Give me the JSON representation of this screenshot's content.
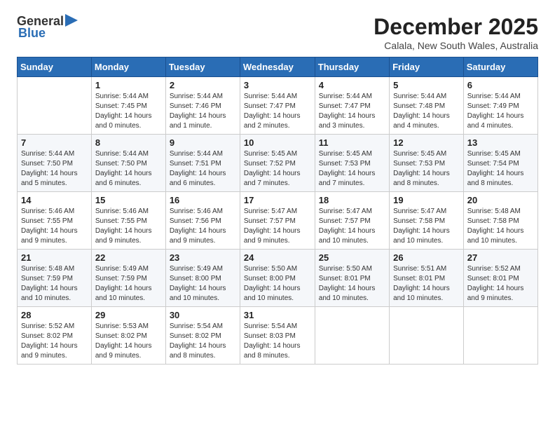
{
  "logo": {
    "text_general": "General",
    "text_blue": "Blue"
  },
  "title": {
    "month": "December 2025",
    "location": "Calala, New South Wales, Australia"
  },
  "weekdays": [
    "Sunday",
    "Monday",
    "Tuesday",
    "Wednesday",
    "Thursday",
    "Friday",
    "Saturday"
  ],
  "weeks": [
    [
      {
        "day": "",
        "sunrise": "",
        "sunset": "",
        "daylight": ""
      },
      {
        "day": "1",
        "sunrise": "Sunrise: 5:44 AM",
        "sunset": "Sunset: 7:45 PM",
        "daylight": "Daylight: 14 hours and 0 minutes."
      },
      {
        "day": "2",
        "sunrise": "Sunrise: 5:44 AM",
        "sunset": "Sunset: 7:46 PM",
        "daylight": "Daylight: 14 hours and 1 minute."
      },
      {
        "day": "3",
        "sunrise": "Sunrise: 5:44 AM",
        "sunset": "Sunset: 7:47 PM",
        "daylight": "Daylight: 14 hours and 2 minutes."
      },
      {
        "day": "4",
        "sunrise": "Sunrise: 5:44 AM",
        "sunset": "Sunset: 7:47 PM",
        "daylight": "Daylight: 14 hours and 3 minutes."
      },
      {
        "day": "5",
        "sunrise": "Sunrise: 5:44 AM",
        "sunset": "Sunset: 7:48 PM",
        "daylight": "Daylight: 14 hours and 4 minutes."
      },
      {
        "day": "6",
        "sunrise": "Sunrise: 5:44 AM",
        "sunset": "Sunset: 7:49 PM",
        "daylight": "Daylight: 14 hours and 4 minutes."
      }
    ],
    [
      {
        "day": "7",
        "sunrise": "Sunrise: 5:44 AM",
        "sunset": "Sunset: 7:50 PM",
        "daylight": "Daylight: 14 hours and 5 minutes."
      },
      {
        "day": "8",
        "sunrise": "Sunrise: 5:44 AM",
        "sunset": "Sunset: 7:50 PM",
        "daylight": "Daylight: 14 hours and 6 minutes."
      },
      {
        "day": "9",
        "sunrise": "Sunrise: 5:44 AM",
        "sunset": "Sunset: 7:51 PM",
        "daylight": "Daylight: 14 hours and 6 minutes."
      },
      {
        "day": "10",
        "sunrise": "Sunrise: 5:45 AM",
        "sunset": "Sunset: 7:52 PM",
        "daylight": "Daylight: 14 hours and 7 minutes."
      },
      {
        "day": "11",
        "sunrise": "Sunrise: 5:45 AM",
        "sunset": "Sunset: 7:53 PM",
        "daylight": "Daylight: 14 hours and 7 minutes."
      },
      {
        "day": "12",
        "sunrise": "Sunrise: 5:45 AM",
        "sunset": "Sunset: 7:53 PM",
        "daylight": "Daylight: 14 hours and 8 minutes."
      },
      {
        "day": "13",
        "sunrise": "Sunrise: 5:45 AM",
        "sunset": "Sunset: 7:54 PM",
        "daylight": "Daylight: 14 hours and 8 minutes."
      }
    ],
    [
      {
        "day": "14",
        "sunrise": "Sunrise: 5:46 AM",
        "sunset": "Sunset: 7:55 PM",
        "daylight": "Daylight: 14 hours and 9 minutes."
      },
      {
        "day": "15",
        "sunrise": "Sunrise: 5:46 AM",
        "sunset": "Sunset: 7:55 PM",
        "daylight": "Daylight: 14 hours and 9 minutes."
      },
      {
        "day": "16",
        "sunrise": "Sunrise: 5:46 AM",
        "sunset": "Sunset: 7:56 PM",
        "daylight": "Daylight: 14 hours and 9 minutes."
      },
      {
        "day": "17",
        "sunrise": "Sunrise: 5:47 AM",
        "sunset": "Sunset: 7:57 PM",
        "daylight": "Daylight: 14 hours and 9 minutes."
      },
      {
        "day": "18",
        "sunrise": "Sunrise: 5:47 AM",
        "sunset": "Sunset: 7:57 PM",
        "daylight": "Daylight: 14 hours and 10 minutes."
      },
      {
        "day": "19",
        "sunrise": "Sunrise: 5:47 AM",
        "sunset": "Sunset: 7:58 PM",
        "daylight": "Daylight: 14 hours and 10 minutes."
      },
      {
        "day": "20",
        "sunrise": "Sunrise: 5:48 AM",
        "sunset": "Sunset: 7:58 PM",
        "daylight": "Daylight: 14 hours and 10 minutes."
      }
    ],
    [
      {
        "day": "21",
        "sunrise": "Sunrise: 5:48 AM",
        "sunset": "Sunset: 7:59 PM",
        "daylight": "Daylight: 14 hours and 10 minutes."
      },
      {
        "day": "22",
        "sunrise": "Sunrise: 5:49 AM",
        "sunset": "Sunset: 7:59 PM",
        "daylight": "Daylight: 14 hours and 10 minutes."
      },
      {
        "day": "23",
        "sunrise": "Sunrise: 5:49 AM",
        "sunset": "Sunset: 8:00 PM",
        "daylight": "Daylight: 14 hours and 10 minutes."
      },
      {
        "day": "24",
        "sunrise": "Sunrise: 5:50 AM",
        "sunset": "Sunset: 8:00 PM",
        "daylight": "Daylight: 14 hours and 10 minutes."
      },
      {
        "day": "25",
        "sunrise": "Sunrise: 5:50 AM",
        "sunset": "Sunset: 8:01 PM",
        "daylight": "Daylight: 14 hours and 10 minutes."
      },
      {
        "day": "26",
        "sunrise": "Sunrise: 5:51 AM",
        "sunset": "Sunset: 8:01 PM",
        "daylight": "Daylight: 14 hours and 10 minutes."
      },
      {
        "day": "27",
        "sunrise": "Sunrise: 5:52 AM",
        "sunset": "Sunset: 8:01 PM",
        "daylight": "Daylight: 14 hours and 9 minutes."
      }
    ],
    [
      {
        "day": "28",
        "sunrise": "Sunrise: 5:52 AM",
        "sunset": "Sunset: 8:02 PM",
        "daylight": "Daylight: 14 hours and 9 minutes."
      },
      {
        "day": "29",
        "sunrise": "Sunrise: 5:53 AM",
        "sunset": "Sunset: 8:02 PM",
        "daylight": "Daylight: 14 hours and 9 minutes."
      },
      {
        "day": "30",
        "sunrise": "Sunrise: 5:54 AM",
        "sunset": "Sunset: 8:02 PM",
        "daylight": "Daylight: 14 hours and 8 minutes."
      },
      {
        "day": "31",
        "sunrise": "Sunrise: 5:54 AM",
        "sunset": "Sunset: 8:03 PM",
        "daylight": "Daylight: 14 hours and 8 minutes."
      },
      {
        "day": "",
        "sunrise": "",
        "sunset": "",
        "daylight": ""
      },
      {
        "day": "",
        "sunrise": "",
        "sunset": "",
        "daylight": ""
      },
      {
        "day": "",
        "sunrise": "",
        "sunset": "",
        "daylight": ""
      }
    ]
  ]
}
